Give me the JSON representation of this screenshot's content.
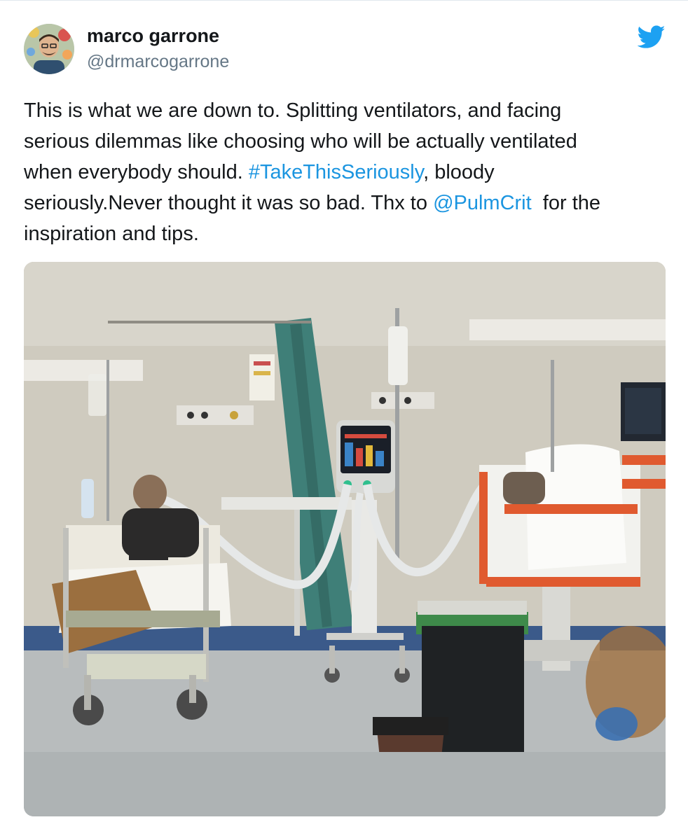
{
  "tweet": {
    "author": {
      "name": "marco garrone",
      "handle": "@drmarcogarrone",
      "avatar_icon": "user-avatar-photo"
    },
    "brand_icon": "twitter-bird-icon",
    "brand_color": "#1da1f2",
    "link_color": "#1b95e0",
    "text_lines": [
      {
        "before": "This is what we are down to. Splitting ventilators, and facing",
        "link": "",
        "after": ""
      },
      {
        "before": "serious dilemmas like choosing who will be actually ventilated",
        "link": "",
        "after": ""
      },
      {
        "before": "when everybody should. ",
        "link": "#TakeThisSeriously",
        "after": ", bloody"
      },
      {
        "before": "seriously.Never thought it was so bad. Thx to ",
        "link": "@PulmCrit",
        "after": "  for the"
      },
      {
        "before": "inspiration and tips.",
        "link": "",
        "after": ""
      }
    ],
    "media": {
      "kind": "photo",
      "subject": "hospital-ward-ventilator-photo"
    }
  }
}
